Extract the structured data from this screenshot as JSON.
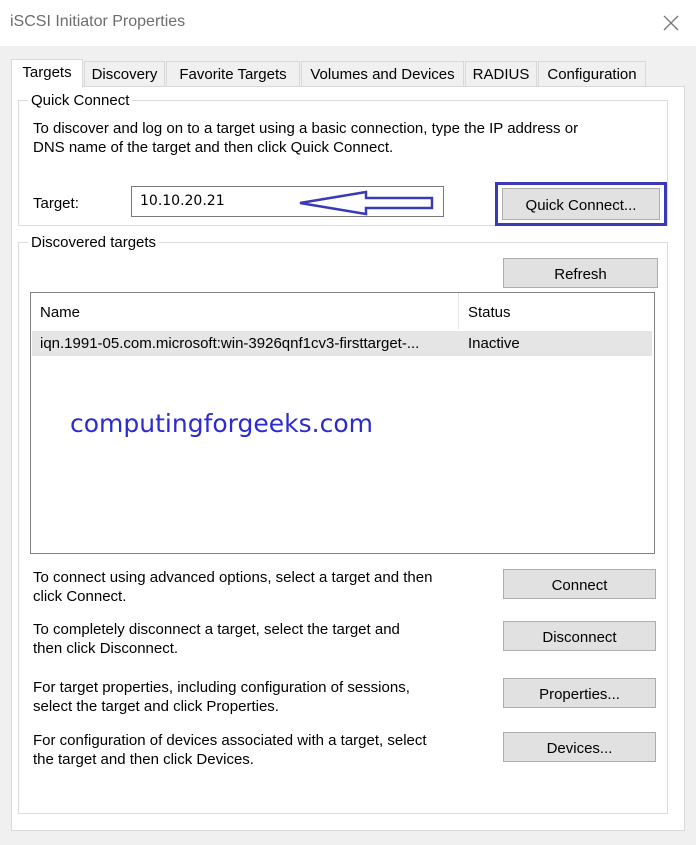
{
  "window": {
    "title": "iSCSI Initiator Properties",
    "close_icon": "close-icon"
  },
  "tabs": [
    {
      "label": "Targets",
      "active": true
    },
    {
      "label": "Discovery"
    },
    {
      "label": "Favorite Targets"
    },
    {
      "label": "Volumes and Devices"
    },
    {
      "label": "RADIUS"
    },
    {
      "label": "Configuration"
    }
  ],
  "quick_connect": {
    "legend": "Quick Connect",
    "description_line1": "To discover and log on to a target using a basic connection, type the IP address or",
    "description_line2": "DNS name of the target and then click Quick Connect.",
    "target_label": "Target:",
    "target_value": "10.10.20.21",
    "button_label": "Quick Connect...",
    "highlight_color": "#3a3ab8",
    "arrow_color": "#3a3ab8"
  },
  "discovered": {
    "legend": "Discovered targets",
    "refresh_label": "Refresh",
    "columns": [
      "Name",
      "Status"
    ],
    "rows": [
      {
        "name": "iqn.1991-05.com.microsoft:win-3926qnf1cv3-firsttarget-...",
        "status": "Inactive"
      }
    ]
  },
  "watermark": "computingforgeeks.com",
  "actions": [
    {
      "line1": "To connect using advanced options, select a target and then",
      "line2": "click Connect.",
      "button": "Connect"
    },
    {
      "line1": "To completely disconnect a target, select the target and",
      "line2": "then click Disconnect.",
      "button": "Disconnect"
    },
    {
      "line1": "For target properties, including configuration of sessions,",
      "line2": "select the target and click Properties.",
      "button": "Properties..."
    },
    {
      "line1": "For configuration of devices associated with a target, select",
      "line2": "the target and then click Devices.",
      "button": "Devices..."
    }
  ]
}
